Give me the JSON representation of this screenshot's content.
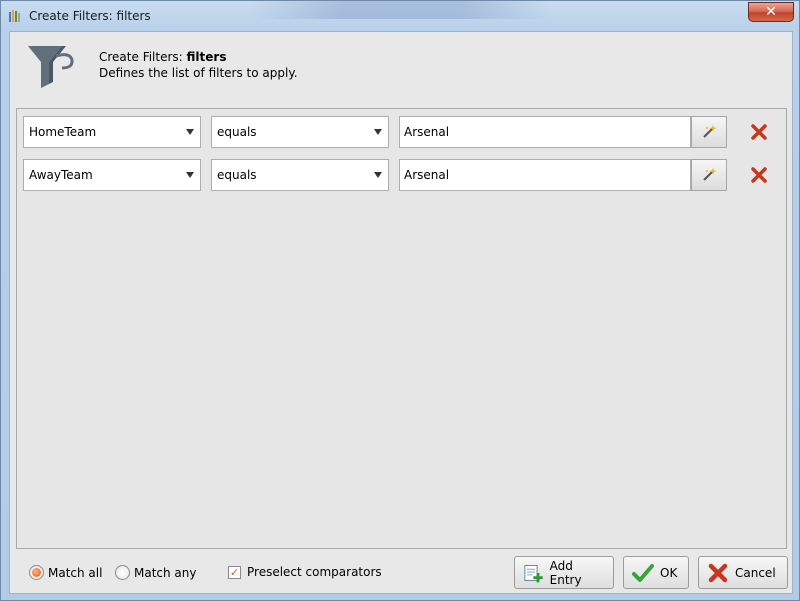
{
  "window": {
    "title": "Create Filters: filters",
    "close_label": "✕"
  },
  "header": {
    "title_prefix": "Create Filters: ",
    "title_name": "filters",
    "description": "Defines the list of filters to apply."
  },
  "filters": [
    {
      "field": "HomeTeam",
      "operator": "equals",
      "value": "Arsenal"
    },
    {
      "field": "AwayTeam",
      "operator": "equals",
      "value": "Arsenal"
    }
  ],
  "footer": {
    "match_all_label": "Match all",
    "match_any_label": "Match any",
    "match_selected": "all",
    "preselect_label": "Preselect comparators",
    "preselect_checked": true,
    "add_entry_label": "Add Entry",
    "ok_label": "OK",
    "cancel_label": "Cancel"
  },
  "colors": {
    "accent": "#e25a12",
    "remove": "#c8361c",
    "funnel": "#5f6f7c"
  }
}
